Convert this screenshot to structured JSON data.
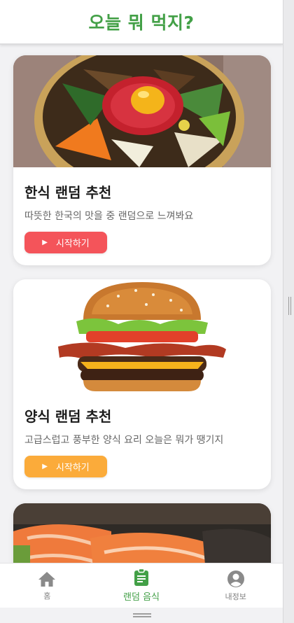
{
  "header": {
    "title": "오늘 뭐 먹지?"
  },
  "cards": [
    {
      "title": "한식 랜덤 추천",
      "description": "따뜻한 한국의 맛을 중 랜덤으로 느껴봐요",
      "button_label": "시작하기",
      "button_color": "#f4545a",
      "image": "bibimbap-image"
    },
    {
      "title": "양식 랜덤 추천",
      "description": "고급스럽고 풍부한 양식 요리 오늘은 뭐가 땡기지",
      "button_label": "시작하기",
      "button_color": "#fbab3a",
      "image": "burger-image"
    },
    {
      "image": "salmon-sushi-image"
    }
  ],
  "bottom_nav": {
    "items": [
      {
        "label": "홈",
        "icon": "home-icon",
        "active": false
      },
      {
        "label": "랜덤 음식",
        "icon": "clipboard-icon",
        "active": true
      },
      {
        "label": "내정보",
        "icon": "user-circle-icon",
        "active": false
      }
    ]
  },
  "colors": {
    "accent": "#43a047",
    "background": "#f2f2f4"
  }
}
